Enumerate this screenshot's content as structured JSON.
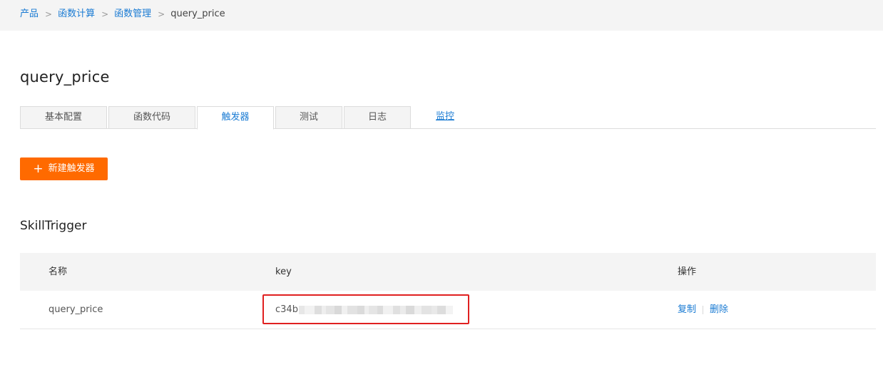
{
  "breadcrumb": {
    "items": [
      "产品",
      "函数计算",
      "函数管理"
    ],
    "separator": ">",
    "current": "query_price"
  },
  "page": {
    "title": "query_price"
  },
  "tabs": [
    {
      "label": "基本配置",
      "active": false
    },
    {
      "label": "函数代码",
      "active": false
    },
    {
      "label": "触发器",
      "active": true
    },
    {
      "label": "测试",
      "active": false
    },
    {
      "label": "日志",
      "active": false
    },
    {
      "label": "监控",
      "active": false,
      "link": true
    }
  ],
  "actions": {
    "new_trigger_icon": "+",
    "new_trigger_label": "新建触发器"
  },
  "section": {
    "title": "SkillTrigger"
  },
  "table": {
    "columns": [
      "名称",
      "key",
      "操作"
    ],
    "rows": [
      {
        "name": "query_price",
        "key_prefix": "c34b",
        "key_obscured": true,
        "actions": [
          "复制",
          "删除"
        ]
      }
    ]
  },
  "colors": {
    "accent": "#1a7bd3",
    "primary_button": "#ff6a00",
    "highlight_border": "#e02020"
  }
}
